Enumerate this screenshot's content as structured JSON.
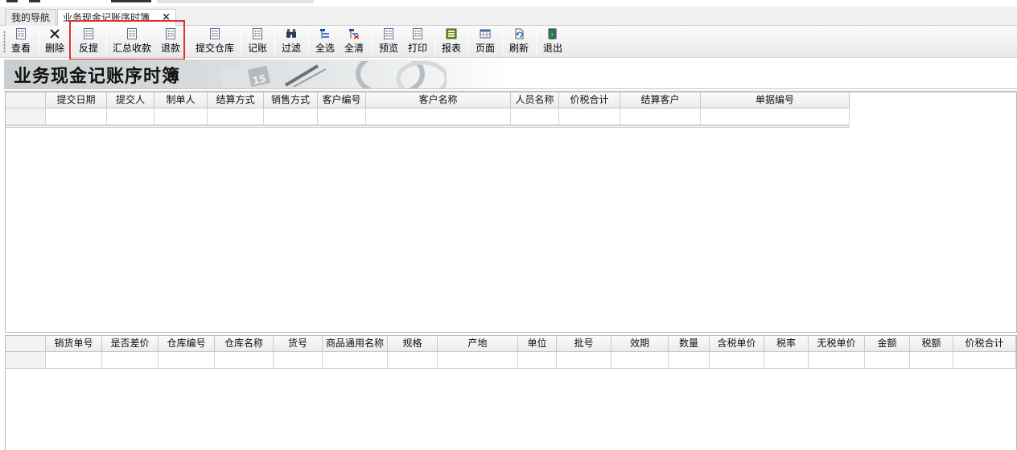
{
  "tabs": {
    "nav_label": "我的导航",
    "active_label": "业务现金记账序时簿",
    "close_glyph": "×"
  },
  "toolbar": {
    "items": [
      {
        "label": "查看",
        "icon": "view-icon"
      },
      {
        "label": "删除",
        "icon": "delete-x-icon"
      },
      {
        "label": "反提",
        "icon": "unsubmit-icon"
      },
      {
        "label": "汇总收款",
        "icon": "summary-receipt-icon"
      },
      {
        "label": "退款",
        "icon": "refund-icon"
      },
      {
        "label": "提交仓库",
        "icon": "submit-warehouse-icon"
      },
      {
        "label": "记账",
        "icon": "post-ledger-icon"
      },
      {
        "label": "过滤",
        "icon": "filter-binoculars-icon"
      },
      {
        "label": "全选",
        "icon": "select-all-icon"
      },
      {
        "label": "全清",
        "icon": "clear-all-icon"
      },
      {
        "label": "预览",
        "icon": "preview-icon"
      },
      {
        "label": "打印",
        "icon": "print-icon"
      },
      {
        "label": "报表",
        "icon": "report-icon"
      },
      {
        "label": "页面",
        "icon": "page-setup-icon"
      },
      {
        "label": "刷新",
        "icon": "refresh-icon"
      },
      {
        "label": "退出",
        "icon": "exit-door-icon"
      }
    ],
    "highlighted": [
      "反提",
      "汇总收款",
      "退款"
    ],
    "highlight_color": "#e03030"
  },
  "banner": {
    "title": "业务现金记账序时簿",
    "decor_number": "15"
  },
  "top_grid": {
    "columns": [
      "提交日期",
      "提交人",
      "制单人",
      "结算方式",
      "销售方式",
      "客户编号",
      "客户名称",
      "人员名称",
      "价税合计",
      "结算客户",
      "单据编号"
    ],
    "rows": [
      [
        "",
        "",
        "",
        "",
        "",
        "",
        "",
        "",
        "",
        "",
        ""
      ]
    ]
  },
  "bottom_grid": {
    "columns": [
      "销货单号",
      "是否差价",
      "仓库编号",
      "仓库名称",
      "货号",
      "商品通用名称",
      "规格",
      "产地",
      "单位",
      "批号",
      "效期",
      "数量",
      "含税单价",
      "税率",
      "无税单价",
      "金额",
      "税额",
      "价税合计"
    ],
    "rows": [
      [
        "",
        "",
        "",
        "",
        "",
        "",
        "",
        "",
        "",
        "",
        "",
        "",
        "",
        "",
        "",
        "",
        "",
        ""
      ]
    ]
  }
}
